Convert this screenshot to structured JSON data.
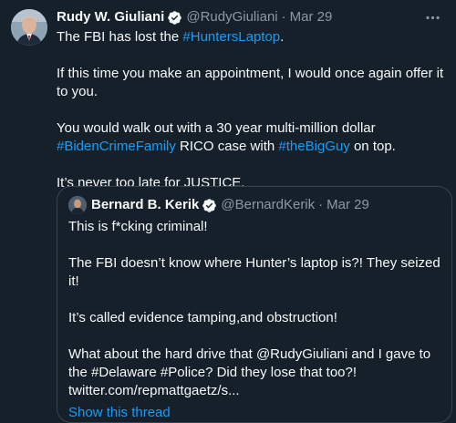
{
  "tweet": {
    "author_name": "Rudy W. Giuliani",
    "handle": "@RudyGiuliani",
    "separator": "·",
    "date": "Mar 29",
    "paragraphs": [
      [
        {
          "text": "The FBI has lost the ",
          "link": false
        },
        {
          "text": "#HuntersLaptop",
          "link": true
        },
        {
          "text": ".",
          "link": false
        }
      ],
      [
        {
          "text": "If this time you make an appointment, I would once again offer it to you.",
          "link": false
        }
      ],
      [
        {
          "text": "You would walk out with a 30 year multi-million dollar ",
          "link": false
        },
        {
          "text": "#BidenCrimeFamily",
          "link": true
        },
        {
          "text": " RICO case with ",
          "link": false
        },
        {
          "text": "#theBigGuy",
          "link": true
        },
        {
          "text": " on top.",
          "link": false
        }
      ],
      [
        {
          "text": "It’s never too late for JUSTICE.",
          "link": false
        }
      ]
    ]
  },
  "quoted": {
    "author_name": "Bernard B. Kerik",
    "handle": "@BernardKerik",
    "separator": "·",
    "date": "Mar 29",
    "paragraphs": [
      "This is f*cking criminal!",
      "The FBI doesn’t know where Hunter’s laptop is?! They seized it!",
      "It’s called evidence tamping,and obstruction!",
      "What about the hard drive that @RudyGiuliani and I gave to the #Delaware #Police? Did they lose that too?! twitter.com/repmattgaetz/s..."
    ],
    "show_thread": "Show this thread"
  },
  "colors": {
    "background": "#15202b",
    "text": "#f7f9f9",
    "muted": "#8b98a5",
    "link": "#1d9bf0",
    "border": "#38444d"
  },
  "icons": {
    "verified": "verified-badge-icon",
    "more": "more-options-icon"
  }
}
